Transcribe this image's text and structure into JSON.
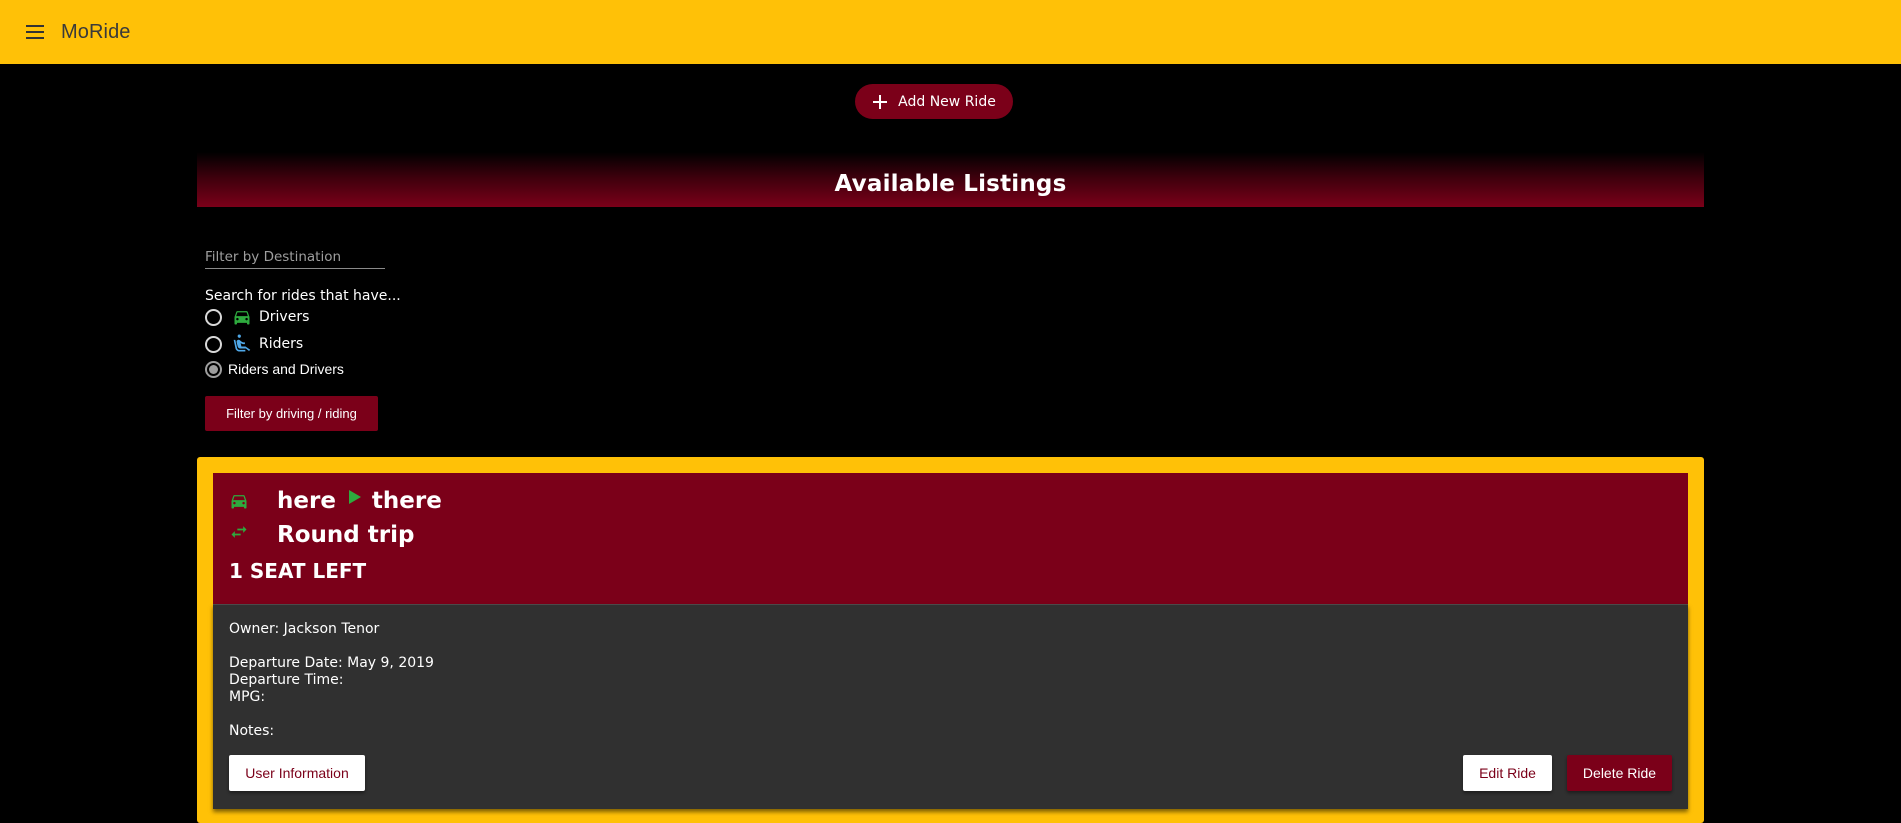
{
  "app": {
    "title": "MoRide"
  },
  "add_ride": {
    "label": "Add New Ride"
  },
  "listings": {
    "heading": "Available Listings"
  },
  "filter": {
    "destination_placeholder": "Filter by Destination",
    "destination_value": "",
    "search_label": "Search for rides that have...",
    "options": [
      {
        "label": "Drivers",
        "icon": "car-icon",
        "checked": false
      },
      {
        "label": "Riders",
        "icon": "seated-person-icon",
        "checked": false
      },
      {
        "label": "Riders and Drivers",
        "icon": "",
        "checked": true
      }
    ],
    "button_label": "Filter by driving / riding"
  },
  "ride": {
    "origin": "here",
    "destination": "there",
    "trip_type": "Round trip",
    "seats": "1 SEAT LEFT",
    "owner": "Owner: Jackson Tenor",
    "departure_date": "Departure Date: May 9, 2019",
    "departure_time": "Departure Time:",
    "mpg": "MPG:",
    "notes": "Notes:",
    "buttons": {
      "user_info": "User Information",
      "edit": "Edit Ride",
      "delete": "Delete Ride"
    }
  },
  "colors": {
    "app_bar": "#FFC107",
    "primary": "#7B0019",
    "icon_green": "#2EAA3E",
    "icon_blue": "#4FA8E8",
    "card_body": "#303030"
  }
}
